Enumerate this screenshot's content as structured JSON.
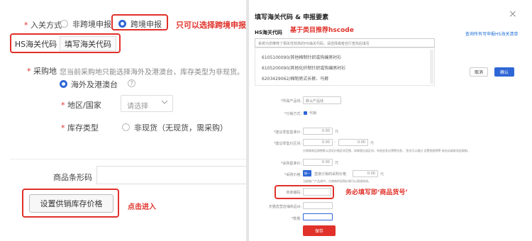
{
  "left": {
    "entry_method_label": "入关方式",
    "option_non_crossborder": "非跨境申报",
    "option_crossborder": "跨境申报",
    "annotation_only_crossborder": "只可以选择跨境申报",
    "tab_hs_code": "HS海关代码",
    "tab_fill_code": "填写海关代码",
    "purchase_label": "采购地",
    "purchase_hint": "您当前采购地只能选择海外及港澳台，库存类型为非现货。",
    "option_overseas": "海外及港澳台",
    "region_label": "地区/国家",
    "region_placeholder": "请选择",
    "stock_type_label": "库存类型",
    "option_non_stock": "非现货（无现货，需采购）",
    "barcode_label": "商品条形码",
    "set_price_button": "设置供销库存价格",
    "annotation_click_enter": "点击进入"
  },
  "modal": {
    "title": "填写海关代码 & 申报要素",
    "close_symbol": "×",
    "hs_section_label": "HS海关代码",
    "annotation_recommend": "基于类目推荐hscode",
    "query_link": "查询所有可申报HS海关清单",
    "search_placeholder": "系统为您推荐了相关性较高的HS海关代码，请选择或者自行查找后填写",
    "suggestions": [
      "6105100090/其他棉制针织或钩编男衬衫",
      "6105200090/其他化纤制针织或钩编男衬衫",
      "6203429062/棉制男式长裤、马裤"
    ],
    "cancel_label": "取消",
    "confirm_label": "确认",
    "category_label": "*所属产品线:",
    "category_value": "默认产品线",
    "share_label": "*分销方式:",
    "share_value": "代销",
    "retail_price_label": "*建议零售基准价:",
    "retail_price_value": "0.00",
    "retail_range_label": "*建议零售价区间:",
    "range_from": "0.00",
    "range_to": "0.00",
    "unit": "元",
    "range_separator": "-",
    "range_note": "分销商商品销售默认验证价格区间范围，如果超出该区间，系统会发出预警信息。 您也可以通过 设置视图预警 来启动或取消此限制。",
    "purchase_price_label": "*采购基准价:",
    "purchase_price_value": "0.00",
    "purchase_mode_label": "*采购价格:",
    "purchase_mode_tag": "统一",
    "purchase_mode_text": "直接分销商采购价格",
    "purchase_mode_value": "0.00",
    "purchase_note": "当前推广产品线中，分销商的采购价格可以直接修改。",
    "merchant_code_label": "商家编码:",
    "annotation_must_fill": "务必填写即‘商品货号’",
    "gift_label": "天猫直营店铺商品id:",
    "quantity_label": "*数量:",
    "save_label": "保存"
  }
}
